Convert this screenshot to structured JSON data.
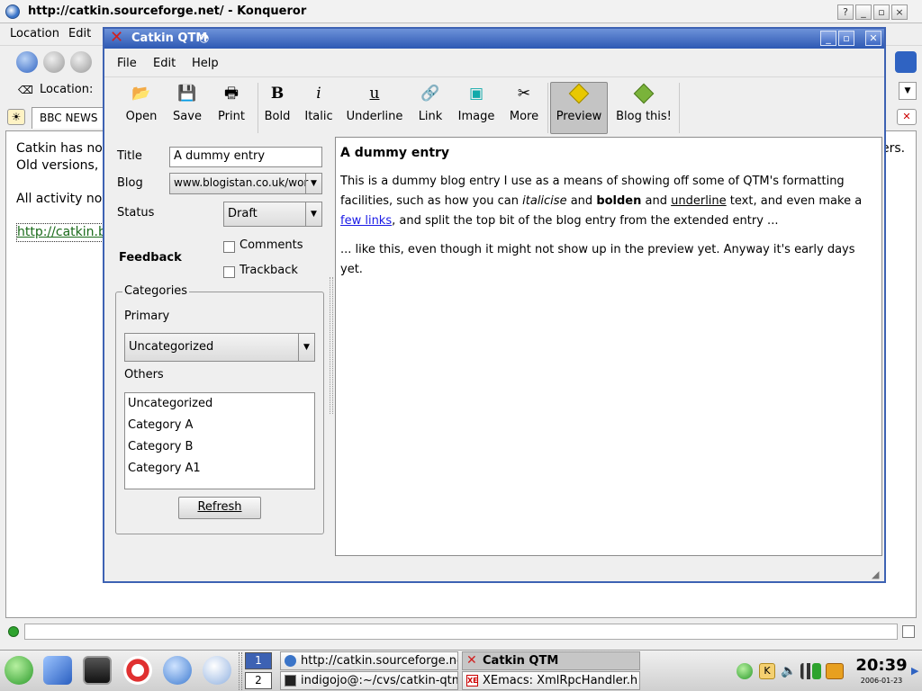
{
  "konqueror": {
    "title": "http://catkin.sourceforge.net/ - Konqueror",
    "menu": [
      "Location",
      "Edit"
    ],
    "location_label": "Location:",
    "tab_label": "BBC NEWS",
    "content": {
      "line1": "Catkin has now",
      "line1_right": "ers.",
      "line2": "Old versions, w",
      "line3": "All activity now",
      "link": "http://catkin.blo"
    }
  },
  "qtm": {
    "title": "Catkin QTM",
    "menu": [
      "File",
      "Edit",
      "Help"
    ],
    "toolbar": {
      "open": "Open",
      "save": "Save",
      "print": "Print",
      "bold": "Bold",
      "italic": "Italic",
      "underline": "Underline",
      "link": "Link",
      "image": "Image",
      "more": "More",
      "preview": "Preview",
      "blog_this": "Blog this!"
    },
    "form": {
      "title_label": "Title",
      "title_value": "A dummy entry",
      "blog_label": "Blog",
      "blog_value": "www.blogistan.co.uk/wor",
      "status_label": "Status",
      "status_value": "Draft",
      "feedback_label": "Feedback",
      "comments_label": "Comments",
      "trackback_label": "Trackback",
      "categories_label": "Categories",
      "primary_label": "Primary",
      "primary_value": "Uncategorized",
      "others_label": "Others",
      "others": [
        "Uncategorized",
        "Category A",
        "Category B",
        "Category A1"
      ],
      "refresh_label": "Refresh"
    },
    "preview": {
      "heading": "A dummy entry",
      "p1_a": "This is a dummy blog entry I use as a means of showing off some of QTM's formatting facilities, such as how you can ",
      "italic": "italicise",
      "p1_b": " and ",
      "bold": "bolden",
      "p1_c": " and ",
      "underline": "underline",
      "p1_d": " text, and even make a ",
      "link": "few links",
      "p1_e": ", and split the top bit of the blog entry from the extended entry ...",
      "p2": "... like this, even though it might not show up in the preview yet. Anyway it's early days yet."
    }
  },
  "taskbar": {
    "desktops": [
      "1",
      "2"
    ],
    "tasks": [
      "http://catkin.sourceforge.net/",
      "Catkin QTM",
      "indigojo@:~/cvs/catkin-qtm -",
      "XEmacs: XmlRpcHandler.h"
    ],
    "clock_time": "20:39",
    "clock_date": "2006-01-23"
  },
  "colors": {
    "qtm_title": "#2d58b3",
    "link": "#1a1ae6",
    "preview_diamond": "#e8c800",
    "blog_diamond": "#7ab33a"
  }
}
